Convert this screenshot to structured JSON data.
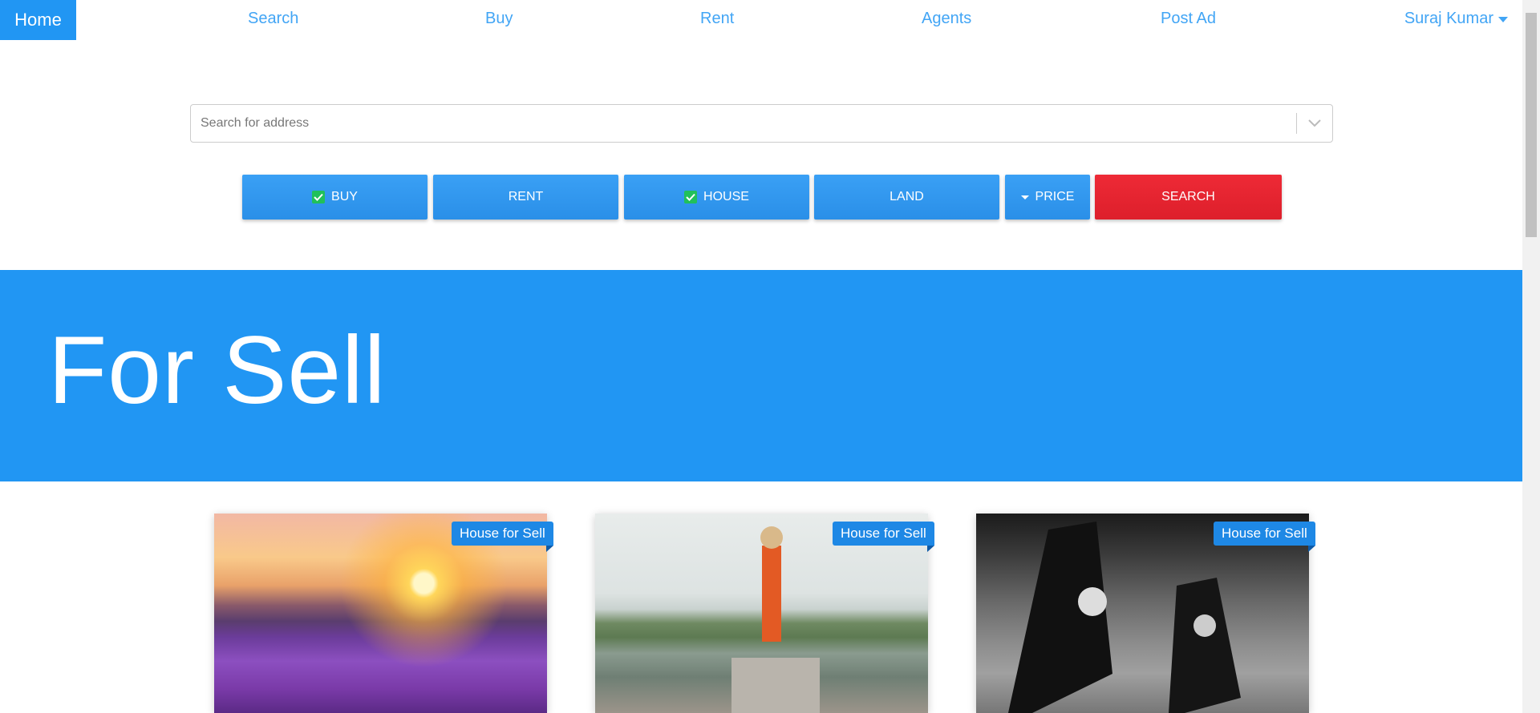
{
  "nav": {
    "home": "Home",
    "links": [
      "Search",
      "Buy",
      "Rent",
      "Agents",
      "Post Ad"
    ],
    "user": "Suraj Kumar"
  },
  "search": {
    "placeholder": "Search for address"
  },
  "filters": {
    "buy": "BUY",
    "rent": "RENT",
    "house": "HOUSE",
    "land": "LAND",
    "price": "PRICE",
    "search": "SEARCH"
  },
  "banner": {
    "title": "For Sell"
  },
  "cards": [
    {
      "tag": "House for Sell",
      "image": "lavender-field-sunset"
    },
    {
      "tag": "House for Sell",
      "image": "orange-statue-river"
    },
    {
      "tag": "House for Sell",
      "image": "sneakers-grayscale"
    }
  ],
  "colors": {
    "primary": "#2196f3",
    "navText": "#42a5f5",
    "search": "#e8222e",
    "check": "#21c05a"
  }
}
